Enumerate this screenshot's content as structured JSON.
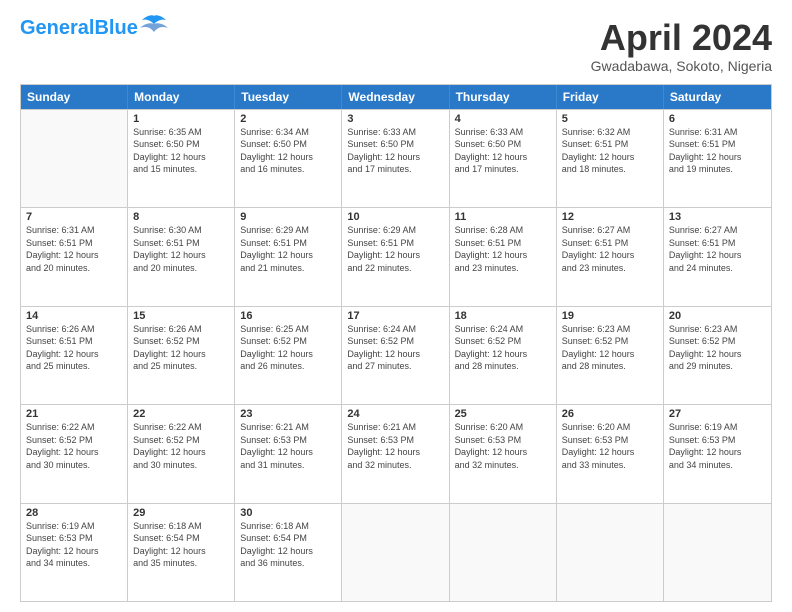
{
  "header": {
    "logo_line1": "General",
    "logo_line2": "Blue",
    "title": "April 2024",
    "location": "Gwadabawa, Sokoto, Nigeria"
  },
  "weekdays": [
    "Sunday",
    "Monday",
    "Tuesday",
    "Wednesday",
    "Thursday",
    "Friday",
    "Saturday"
  ],
  "weeks": [
    [
      {
        "day": "",
        "info": ""
      },
      {
        "day": "1",
        "info": "Sunrise: 6:35 AM\nSunset: 6:50 PM\nDaylight: 12 hours\nand 15 minutes."
      },
      {
        "day": "2",
        "info": "Sunrise: 6:34 AM\nSunset: 6:50 PM\nDaylight: 12 hours\nand 16 minutes."
      },
      {
        "day": "3",
        "info": "Sunrise: 6:33 AM\nSunset: 6:50 PM\nDaylight: 12 hours\nand 17 minutes."
      },
      {
        "day": "4",
        "info": "Sunrise: 6:33 AM\nSunset: 6:50 PM\nDaylight: 12 hours\nand 17 minutes."
      },
      {
        "day": "5",
        "info": "Sunrise: 6:32 AM\nSunset: 6:51 PM\nDaylight: 12 hours\nand 18 minutes."
      },
      {
        "day": "6",
        "info": "Sunrise: 6:31 AM\nSunset: 6:51 PM\nDaylight: 12 hours\nand 19 minutes."
      }
    ],
    [
      {
        "day": "7",
        "info": "Sunrise: 6:31 AM\nSunset: 6:51 PM\nDaylight: 12 hours\nand 20 minutes."
      },
      {
        "day": "8",
        "info": "Sunrise: 6:30 AM\nSunset: 6:51 PM\nDaylight: 12 hours\nand 20 minutes."
      },
      {
        "day": "9",
        "info": "Sunrise: 6:29 AM\nSunset: 6:51 PM\nDaylight: 12 hours\nand 21 minutes."
      },
      {
        "day": "10",
        "info": "Sunrise: 6:29 AM\nSunset: 6:51 PM\nDaylight: 12 hours\nand 22 minutes."
      },
      {
        "day": "11",
        "info": "Sunrise: 6:28 AM\nSunset: 6:51 PM\nDaylight: 12 hours\nand 23 minutes."
      },
      {
        "day": "12",
        "info": "Sunrise: 6:27 AM\nSunset: 6:51 PM\nDaylight: 12 hours\nand 23 minutes."
      },
      {
        "day": "13",
        "info": "Sunrise: 6:27 AM\nSunset: 6:51 PM\nDaylight: 12 hours\nand 24 minutes."
      }
    ],
    [
      {
        "day": "14",
        "info": "Sunrise: 6:26 AM\nSunset: 6:51 PM\nDaylight: 12 hours\nand 25 minutes."
      },
      {
        "day": "15",
        "info": "Sunrise: 6:26 AM\nSunset: 6:52 PM\nDaylight: 12 hours\nand 25 minutes."
      },
      {
        "day": "16",
        "info": "Sunrise: 6:25 AM\nSunset: 6:52 PM\nDaylight: 12 hours\nand 26 minutes."
      },
      {
        "day": "17",
        "info": "Sunrise: 6:24 AM\nSunset: 6:52 PM\nDaylight: 12 hours\nand 27 minutes."
      },
      {
        "day": "18",
        "info": "Sunrise: 6:24 AM\nSunset: 6:52 PM\nDaylight: 12 hours\nand 28 minutes."
      },
      {
        "day": "19",
        "info": "Sunrise: 6:23 AM\nSunset: 6:52 PM\nDaylight: 12 hours\nand 28 minutes."
      },
      {
        "day": "20",
        "info": "Sunrise: 6:23 AM\nSunset: 6:52 PM\nDaylight: 12 hours\nand 29 minutes."
      }
    ],
    [
      {
        "day": "21",
        "info": "Sunrise: 6:22 AM\nSunset: 6:52 PM\nDaylight: 12 hours\nand 30 minutes."
      },
      {
        "day": "22",
        "info": "Sunrise: 6:22 AM\nSunset: 6:52 PM\nDaylight: 12 hours\nand 30 minutes."
      },
      {
        "day": "23",
        "info": "Sunrise: 6:21 AM\nSunset: 6:53 PM\nDaylight: 12 hours\nand 31 minutes."
      },
      {
        "day": "24",
        "info": "Sunrise: 6:21 AM\nSunset: 6:53 PM\nDaylight: 12 hours\nand 32 minutes."
      },
      {
        "day": "25",
        "info": "Sunrise: 6:20 AM\nSunset: 6:53 PM\nDaylight: 12 hours\nand 32 minutes."
      },
      {
        "day": "26",
        "info": "Sunrise: 6:20 AM\nSunset: 6:53 PM\nDaylight: 12 hours\nand 33 minutes."
      },
      {
        "day": "27",
        "info": "Sunrise: 6:19 AM\nSunset: 6:53 PM\nDaylight: 12 hours\nand 34 minutes."
      }
    ],
    [
      {
        "day": "28",
        "info": "Sunrise: 6:19 AM\nSunset: 6:53 PM\nDaylight: 12 hours\nand 34 minutes."
      },
      {
        "day": "29",
        "info": "Sunrise: 6:18 AM\nSunset: 6:54 PM\nDaylight: 12 hours\nand 35 minutes."
      },
      {
        "day": "30",
        "info": "Sunrise: 6:18 AM\nSunset: 6:54 PM\nDaylight: 12 hours\nand 36 minutes."
      },
      {
        "day": "",
        "info": ""
      },
      {
        "day": "",
        "info": ""
      },
      {
        "day": "",
        "info": ""
      },
      {
        "day": "",
        "info": ""
      }
    ]
  ]
}
